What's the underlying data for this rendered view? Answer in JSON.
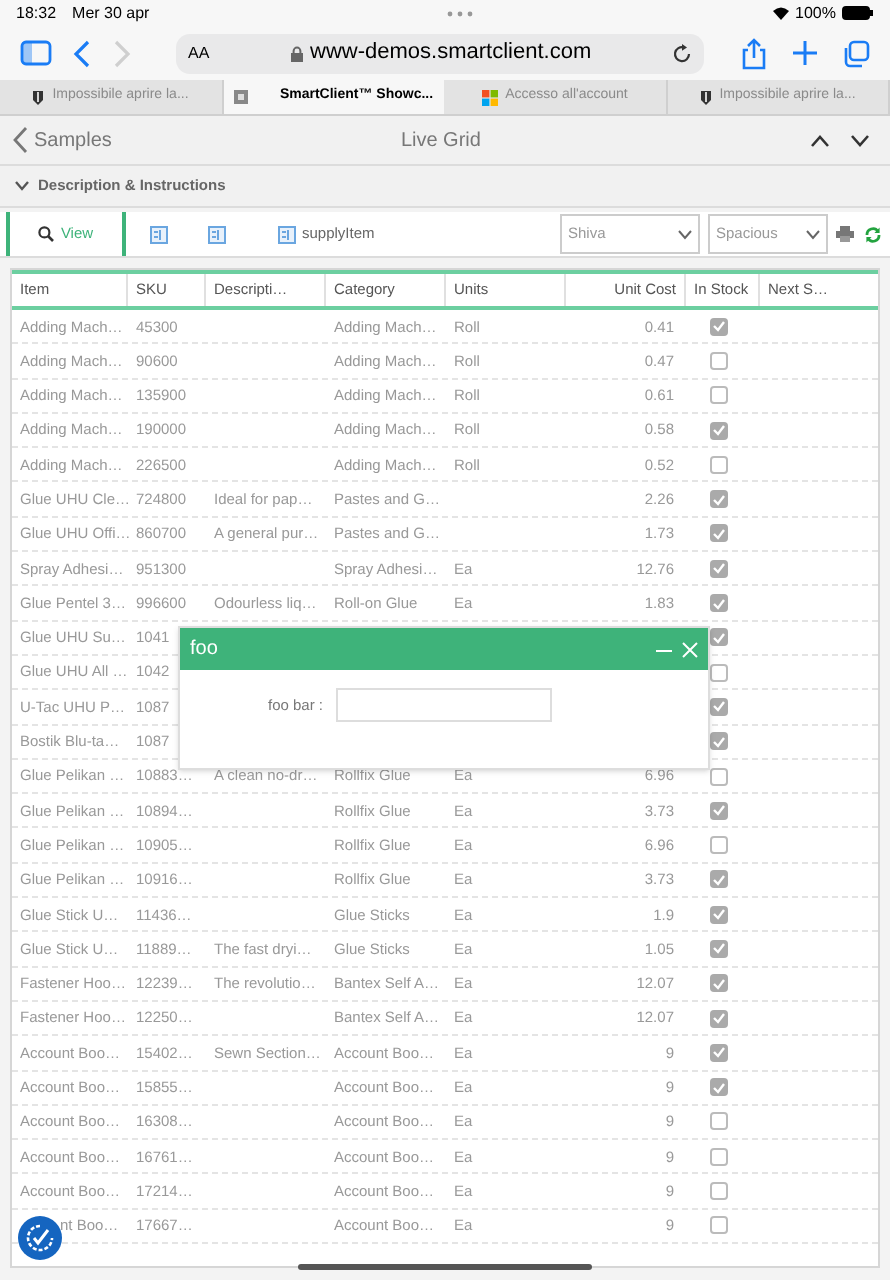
{
  "status_bar": {
    "time": "18:32",
    "date": "Mer 30 apr",
    "battery": "100%"
  },
  "browser": {
    "text_size": "AA",
    "url": "www-demos.smartclient.com",
    "forward_disabled": true
  },
  "tabs": [
    {
      "label": "Impossibile aprire la...",
      "selected": false,
      "kind": "shield"
    },
    {
      "label": "SmartClient™ Showc...",
      "selected": true,
      "kind": "square"
    },
    {
      "label": "Accesso all'account",
      "selected": false,
      "kind": "windows"
    },
    {
      "label": "Impossibile aprire la...",
      "selected": false,
      "kind": "shield"
    }
  ],
  "header": {
    "back": "Samples",
    "title": "Live Grid"
  },
  "section": {
    "title": "Description & Instructions",
    "expanded": true
  },
  "toolbar": {
    "view": "View",
    "datasource": "supplyItem",
    "skin": "Shiva",
    "density": "Spacious"
  },
  "grid": {
    "columns": [
      "Item",
      "SKU",
      "Descripti…",
      "Category",
      "Units",
      "Unit Cost",
      "In Stock",
      "Next S…"
    ],
    "rows": [
      {
        "item": "Adding Mach…",
        "sku": "45300",
        "description": "",
        "category": "Adding Mach…",
        "units": "Roll",
        "cost": "0.41",
        "in_stock": true
      },
      {
        "item": "Adding Mach…",
        "sku": "90600",
        "description": "",
        "category": "Adding Mach…",
        "units": "Roll",
        "cost": "0.47",
        "in_stock": false
      },
      {
        "item": "Adding Mach…",
        "sku": "135900",
        "description": "",
        "category": "Adding Mach…",
        "units": "Roll",
        "cost": "0.61",
        "in_stock": false
      },
      {
        "item": "Adding Mach…",
        "sku": "190000",
        "description": "",
        "category": "Adding Mach…",
        "units": "Roll",
        "cost": "0.58",
        "in_stock": true
      },
      {
        "item": "Adding Mach…",
        "sku": "226500",
        "description": "",
        "category": "Adding Mach…",
        "units": "Roll",
        "cost": "0.52",
        "in_stock": false
      },
      {
        "item": "Glue UHU Cle…",
        "sku": "724800",
        "description": "Ideal for pap…",
        "category": "Pastes and G…",
        "units": "",
        "cost": "2.26",
        "in_stock": true
      },
      {
        "item": "Glue UHU Offi…",
        "sku": "860700",
        "description": "A general pur…",
        "category": "Pastes and G…",
        "units": "",
        "cost": "1.73",
        "in_stock": true
      },
      {
        "item": "Spray Adhesi…",
        "sku": "951300",
        "description": "",
        "category": "Spray Adhesi…",
        "units": "Ea",
        "cost": "12.76",
        "in_stock": true
      },
      {
        "item": "Glue Pentel 3…",
        "sku": "996600",
        "description": "Odourless liq…",
        "category": "Roll-on Glue",
        "units": "Ea",
        "cost": "1.83",
        "in_stock": true
      },
      {
        "item": "Glue UHU Su…",
        "sku": "1041",
        "in_stock": true
      },
      {
        "item": "Glue UHU All …",
        "sku": "1042",
        "in_stock": false
      },
      {
        "item": "U-Tac UHU P…",
        "sku": "1087",
        "in_stock": true
      },
      {
        "item": "Bostik Blu-ta…",
        "sku": "1087",
        "in_stock": true
      },
      {
        "item": "Glue Pelikan …",
        "sku": "10883…",
        "description": "A clean no-dr…",
        "category": "Rollfix Glue",
        "units": "Ea",
        "cost": "6.96",
        "in_stock": false
      },
      {
        "item": "Glue Pelikan …",
        "sku": "10894…",
        "description": "",
        "category": "Rollfix Glue",
        "units": "Ea",
        "cost": "3.73",
        "in_stock": true
      },
      {
        "item": "Glue Pelikan …",
        "sku": "10905…",
        "description": "",
        "category": "Rollfix Glue",
        "units": "Ea",
        "cost": "6.96",
        "in_stock": false
      },
      {
        "item": "Glue Pelikan …",
        "sku": "10916…",
        "description": "",
        "category": "Rollfix Glue",
        "units": "Ea",
        "cost": "3.73",
        "in_stock": true
      },
      {
        "item": "Glue Stick U…",
        "sku": "11436…",
        "description": "",
        "category": "Glue Sticks",
        "units": "Ea",
        "cost": "1.9",
        "in_stock": true
      },
      {
        "item": "Glue Stick U…",
        "sku": "11889…",
        "description": "The fast dryi…",
        "category": "Glue Sticks",
        "units": "Ea",
        "cost": "1.05",
        "in_stock": true
      },
      {
        "item": "Fastener Hoo…",
        "sku": "12239…",
        "description": "The revolutio…",
        "category": "Bantex Self A…",
        "units": "Ea",
        "cost": "12.07",
        "in_stock": true
      },
      {
        "item": "Fastener Hoo…",
        "sku": "12250…",
        "description": "",
        "category": "Bantex Self A…",
        "units": "Ea",
        "cost": "12.07",
        "in_stock": true
      },
      {
        "item": "Account Boo…",
        "sku": "15402…",
        "description": "Sewn Section…",
        "category": "Account Boo…",
        "units": "Ea",
        "cost": "9",
        "in_stock": true
      },
      {
        "item": "Account Boo…",
        "sku": "15855…",
        "description": "",
        "category": "Account Boo…",
        "units": "Ea",
        "cost": "9",
        "in_stock": true
      },
      {
        "item": "Account Boo…",
        "sku": "16308…",
        "description": "",
        "category": "Account Boo…",
        "units": "Ea",
        "cost": "9",
        "in_stock": false
      },
      {
        "item": "Account Boo…",
        "sku": "16761…",
        "description": "",
        "category": "Account Boo…",
        "units": "Ea",
        "cost": "9",
        "in_stock": false
      },
      {
        "item": "Account Boo…",
        "sku": "17214…",
        "description": "",
        "category": "Account Boo…",
        "units": "Ea",
        "cost": "9",
        "in_stock": false
      },
      {
        "item": "nt Boo…",
        "sku": "17667…",
        "description": "",
        "category": "Account Boo…",
        "units": "Ea",
        "cost": "9",
        "in_stock": false
      }
    ]
  },
  "dialog": {
    "title": "foo",
    "field_label": "foo bar :"
  }
}
